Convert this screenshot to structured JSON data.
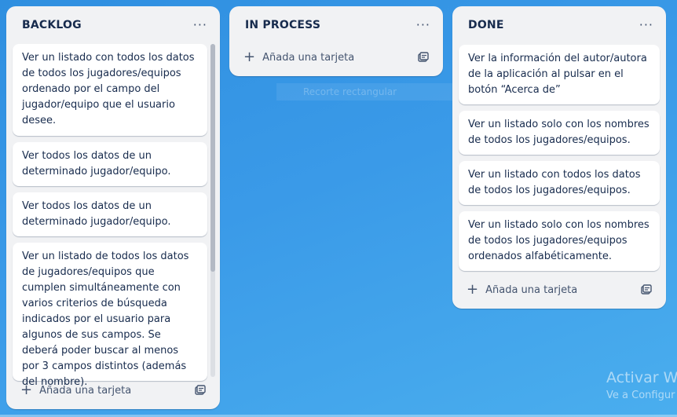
{
  "board": {
    "lists": [
      {
        "title": "BACKLOG",
        "menu": "···",
        "cards": [
          "Ver un listado con todos los datos de todos los jugadores/equipos ordenado por el campo del jugador/equipo que el usuario desee.",
          "Ver todos los datos de un determinado jugador/equipo.",
          "Ver todos los datos de un determinado jugador/equipo.",
          "Ver un listado de todos los datos de jugadores/equipos que cumplen simultáneamente con varios criterios de búsqueda indicados por el usuario para algunos de sus campos. Se deberá poder buscar al menos por 3 campos distintos (además del nombre)."
        ],
        "add_label": "Añada una tarjeta"
      },
      {
        "title": "IN PROCESS",
        "menu": "···",
        "cards": [],
        "add_label": "Añada una tarjeta"
      },
      {
        "title": "DONE",
        "menu": "···",
        "cards": [
          "Ver la información del autor/autora de la aplicación al pulsar en el botón “Acerca de”",
          "Ver un listado solo con los nombres de todos los jugadores/equipos.",
          "Ver un listado con todos los datos de todos los jugadores/equipos.",
          "Ver un listado solo con los nombres de todos los jugadores/equipos ordenados alfabéticamente."
        ],
        "add_label": "Añada una tarjeta"
      }
    ],
    "ghost_text": "Recorte rectangular"
  },
  "watermark": {
    "line1": "Activar Wi",
    "line2": "Ve a Configur"
  },
  "icons": {
    "menu": "dots-icon",
    "add": "plus-icon",
    "template": "card-template-icon"
  }
}
